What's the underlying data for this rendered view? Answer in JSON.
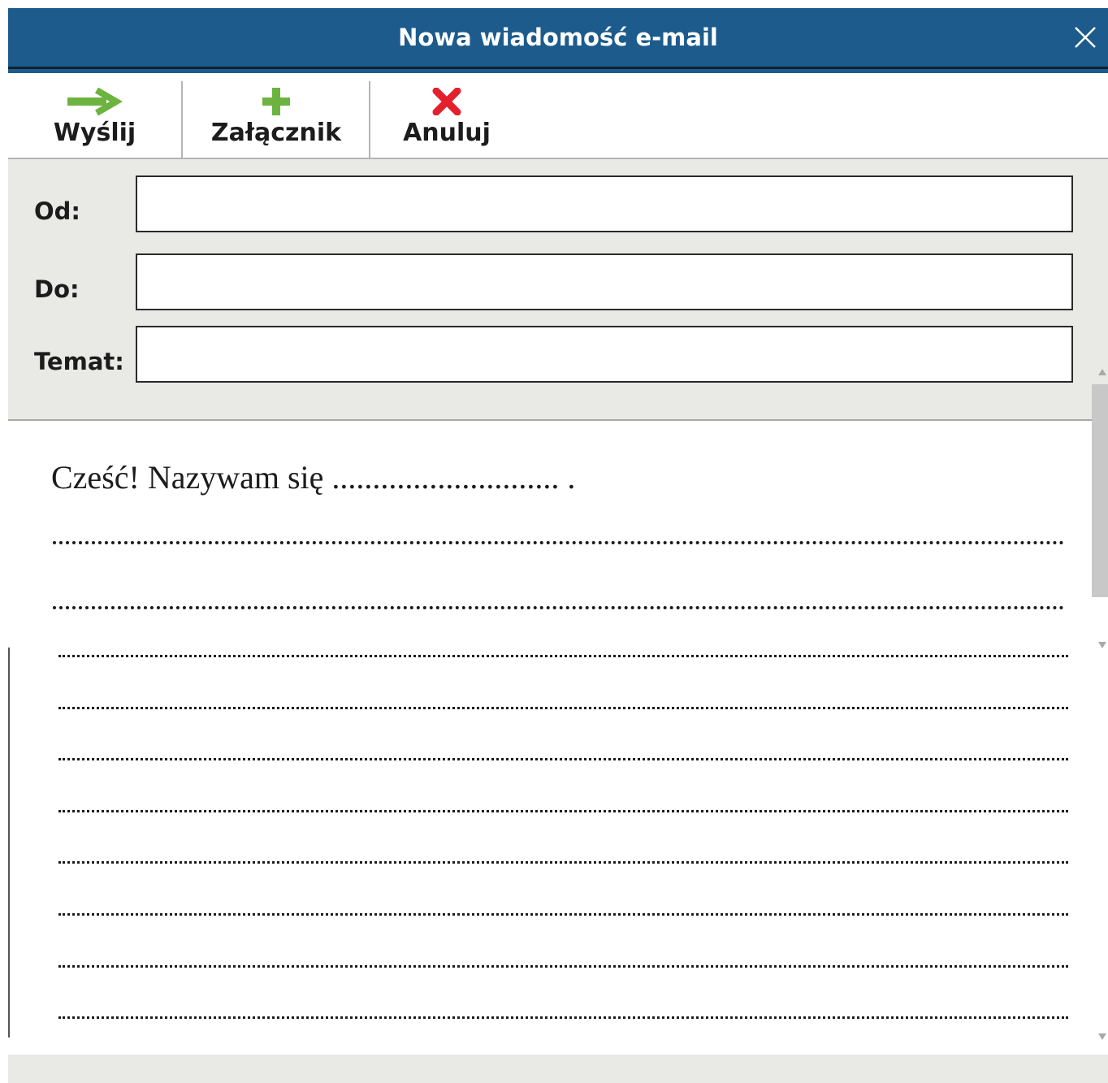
{
  "window": {
    "title": "Nowa wiadomość e-mail"
  },
  "toolbar": {
    "send_label": "Wyślij",
    "attach_label": "Załącznik",
    "cancel_label": "Anuluj"
  },
  "fields": {
    "from_label": "Od:",
    "to_label": "Do:",
    "subject_label": "Temat:",
    "from_value": "",
    "to_value": "",
    "subject_value": ""
  },
  "message": {
    "greeting": "Cześć! Nazywam się ............................ .",
    "blank_lines": 10
  },
  "colors": {
    "title_bar": "#1c5b8c",
    "send_icon": "#6cb33f",
    "attach_icon": "#6cb33f",
    "cancel_icon": "#e3202c",
    "header_bg": "#e9e9e5"
  },
  "icons": {
    "send": "arrow-right-icon",
    "attach": "plus-icon",
    "cancel": "x-icon",
    "close": "close-icon"
  }
}
